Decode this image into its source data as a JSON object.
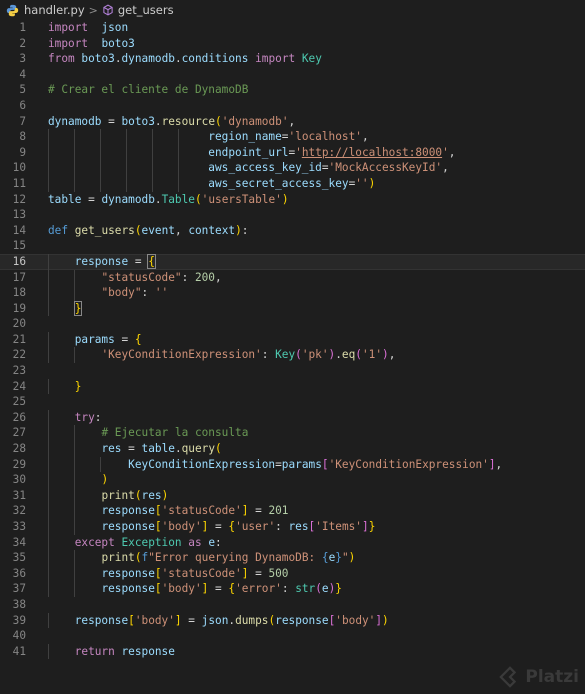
{
  "breadcrumb": {
    "file": "handler.py",
    "symbol": "get_users",
    "separator": ">"
  },
  "editor": {
    "current_line": 16,
    "lines": [
      {
        "n": "1",
        "t": [
          [
            "kw2",
            "import"
          ],
          [
            "",
            "  "
          ],
          [
            "var",
            "json"
          ]
        ]
      },
      {
        "n": "2",
        "t": [
          [
            "kw2",
            "import"
          ],
          [
            "",
            "  "
          ],
          [
            "var",
            "boto3"
          ]
        ]
      },
      {
        "n": "3",
        "t": [
          [
            "kw2",
            "from"
          ],
          [
            "",
            " "
          ],
          [
            "var",
            "boto3"
          ],
          [
            "",
            "."
          ],
          [
            "var",
            "dynamodb"
          ],
          [
            "",
            "."
          ],
          [
            "var",
            "conditions"
          ],
          [
            "",
            " "
          ],
          [
            "kw2",
            "import"
          ],
          [
            "",
            " "
          ],
          [
            "cls",
            "Key"
          ]
        ]
      },
      {
        "n": "4",
        "t": []
      },
      {
        "n": "5",
        "t": [
          [
            "cm",
            "# Crear el cliente de DynamoDB"
          ]
        ]
      },
      {
        "n": "6",
        "t": []
      },
      {
        "n": "7",
        "t": [
          [
            "var",
            "dynamodb"
          ],
          [
            "",
            " = "
          ],
          [
            "var",
            "boto3"
          ],
          [
            "",
            "."
          ],
          [
            "fn",
            "resource"
          ],
          [
            "br1",
            "("
          ],
          [
            "str",
            "'dynamodb'"
          ],
          [
            "",
            ","
          ]
        ]
      },
      {
        "n": "8",
        "t": [
          [
            "",
            "                        "
          ],
          [
            "var",
            "region_name"
          ],
          [
            "",
            "="
          ],
          [
            "str",
            "'localhost'"
          ],
          [
            "",
            ","
          ]
        ]
      },
      {
        "n": "9",
        "t": [
          [
            "",
            "                        "
          ],
          [
            "var",
            "endpoint_url"
          ],
          [
            "",
            "="
          ],
          [
            "str",
            "'"
          ],
          [
            "url",
            "http://localhost:8000"
          ],
          [
            "str",
            "'"
          ],
          [
            "",
            ","
          ]
        ]
      },
      {
        "n": "10",
        "t": [
          [
            "",
            "                        "
          ],
          [
            "var",
            "aws_access_key_id"
          ],
          [
            "",
            "="
          ],
          [
            "str",
            "'MockAccessKeyId'"
          ],
          [
            "",
            ","
          ]
        ]
      },
      {
        "n": "11",
        "t": [
          [
            "",
            "                        "
          ],
          [
            "var",
            "aws_secret_access_key"
          ],
          [
            "",
            "="
          ],
          [
            "str",
            "''"
          ],
          [
            "br1",
            ")"
          ]
        ]
      },
      {
        "n": "12",
        "t": [
          [
            "var",
            "table"
          ],
          [
            "",
            " = "
          ],
          [
            "var",
            "dynamodb"
          ],
          [
            "",
            "."
          ],
          [
            "cls",
            "Table"
          ],
          [
            "br1",
            "("
          ],
          [
            "str",
            "'usersTable'"
          ],
          [
            "br1",
            ")"
          ]
        ]
      },
      {
        "n": "13",
        "t": []
      },
      {
        "n": "14",
        "t": [
          [
            "kw",
            "def"
          ],
          [
            "",
            " "
          ],
          [
            "fn",
            "get_users"
          ],
          [
            "br1",
            "("
          ],
          [
            "var",
            "event"
          ],
          [
            "",
            ", "
          ],
          [
            "var",
            "context"
          ],
          [
            "br1",
            ")"
          ],
          [
            "",
            ":"
          ]
        ]
      },
      {
        "n": "15",
        "t": []
      },
      {
        "n": "16",
        "t": [
          [
            "",
            "    "
          ],
          [
            "var",
            "response"
          ],
          [
            "",
            " = "
          ],
          [
            "br1 brbox",
            "{"
          ]
        ]
      },
      {
        "n": "17",
        "t": [
          [
            "",
            "        "
          ],
          [
            "str",
            "\"statusCode\""
          ],
          [
            "",
            ": "
          ],
          [
            "num",
            "200"
          ],
          [
            "",
            ","
          ]
        ]
      },
      {
        "n": "18",
        "t": [
          [
            "",
            "        "
          ],
          [
            "str",
            "\"body\""
          ],
          [
            "",
            ": "
          ],
          [
            "str",
            "''"
          ]
        ]
      },
      {
        "n": "19",
        "t": [
          [
            "",
            "    "
          ],
          [
            "br1 brbox",
            "}"
          ]
        ]
      },
      {
        "n": "20",
        "t": []
      },
      {
        "n": "21",
        "t": [
          [
            "",
            "    "
          ],
          [
            "var",
            "params"
          ],
          [
            "",
            " = "
          ],
          [
            "br1",
            "{"
          ]
        ]
      },
      {
        "n": "22",
        "t": [
          [
            "",
            "        "
          ],
          [
            "str",
            "'KeyConditionExpression'"
          ],
          [
            "",
            ": "
          ],
          [
            "cls",
            "Key"
          ],
          [
            "br2",
            "("
          ],
          [
            "str",
            "'pk'"
          ],
          [
            "br2",
            ")"
          ],
          [
            "",
            "."
          ],
          [
            "fn",
            "eq"
          ],
          [
            "br2",
            "("
          ],
          [
            "str",
            "'1'"
          ],
          [
            "br2",
            ")"
          ],
          [
            "",
            ","
          ]
        ]
      },
      {
        "n": "23",
        "t": []
      },
      {
        "n": "24",
        "t": [
          [
            "",
            "    "
          ],
          [
            "br1",
            "}"
          ]
        ]
      },
      {
        "n": "25",
        "t": []
      },
      {
        "n": "26",
        "t": [
          [
            "",
            "    "
          ],
          [
            "kw2",
            "try"
          ],
          [
            "",
            ":"
          ]
        ]
      },
      {
        "n": "27",
        "t": [
          [
            "",
            "        "
          ],
          [
            "cm",
            "# Ejecutar la consulta"
          ]
        ]
      },
      {
        "n": "28",
        "t": [
          [
            "",
            "        "
          ],
          [
            "var",
            "res"
          ],
          [
            "",
            " = "
          ],
          [
            "var",
            "table"
          ],
          [
            "",
            "."
          ],
          [
            "fn",
            "query"
          ],
          [
            "br1",
            "("
          ]
        ]
      },
      {
        "n": "29",
        "t": [
          [
            "",
            "            "
          ],
          [
            "var",
            "KeyConditionExpression"
          ],
          [
            "",
            "="
          ],
          [
            "var",
            "params"
          ],
          [
            "br2",
            "["
          ],
          [
            "str",
            "'KeyConditionExpression'"
          ],
          [
            "br2",
            "]"
          ],
          [
            "",
            ","
          ]
        ]
      },
      {
        "n": "30",
        "t": [
          [
            "",
            "        "
          ],
          [
            "br1",
            ")"
          ]
        ]
      },
      {
        "n": "31",
        "t": [
          [
            "",
            "        "
          ],
          [
            "fn",
            "print"
          ],
          [
            "br1",
            "("
          ],
          [
            "var",
            "res"
          ],
          [
            "br1",
            ")"
          ]
        ]
      },
      {
        "n": "32",
        "t": [
          [
            "",
            "        "
          ],
          [
            "var",
            "response"
          ],
          [
            "br1",
            "["
          ],
          [
            "str",
            "'statusCode'"
          ],
          [
            "br1",
            "]"
          ],
          [
            "",
            " = "
          ],
          [
            "num",
            "201"
          ]
        ]
      },
      {
        "n": "33",
        "t": [
          [
            "",
            "        "
          ],
          [
            "var",
            "response"
          ],
          [
            "br1",
            "["
          ],
          [
            "str",
            "'body'"
          ],
          [
            "br1",
            "]"
          ],
          [
            "",
            " = "
          ],
          [
            "br1",
            "{"
          ],
          [
            "str",
            "'user'"
          ],
          [
            "",
            ": "
          ],
          [
            "var",
            "res"
          ],
          [
            "br2",
            "["
          ],
          [
            "str",
            "'Items'"
          ],
          [
            "br2",
            "]"
          ],
          [
            "br1",
            "}"
          ]
        ]
      },
      {
        "n": "34",
        "t": [
          [
            "",
            "    "
          ],
          [
            "kw2",
            "except"
          ],
          [
            "",
            " "
          ],
          [
            "cls",
            "Exception"
          ],
          [
            "",
            " "
          ],
          [
            "kw2",
            "as"
          ],
          [
            "",
            " "
          ],
          [
            "var",
            "e"
          ],
          [
            "",
            ":"
          ]
        ]
      },
      {
        "n": "35",
        "t": [
          [
            "",
            "        "
          ],
          [
            "fn",
            "print"
          ],
          [
            "br1",
            "("
          ],
          [
            "kw",
            "f"
          ],
          [
            "str",
            "\"Error querying DynamoDB: "
          ],
          [
            "kw",
            "{"
          ],
          [
            "var",
            "e"
          ],
          [
            "kw",
            "}"
          ],
          [
            "str",
            "\""
          ],
          [
            "br1",
            ")"
          ]
        ]
      },
      {
        "n": "36",
        "t": [
          [
            "",
            "        "
          ],
          [
            "var",
            "response"
          ],
          [
            "br1",
            "["
          ],
          [
            "str",
            "'statusCode'"
          ],
          [
            "br1",
            "]"
          ],
          [
            "",
            " = "
          ],
          [
            "num",
            "500"
          ]
        ]
      },
      {
        "n": "37",
        "t": [
          [
            "",
            "        "
          ],
          [
            "var",
            "response"
          ],
          [
            "br1",
            "["
          ],
          [
            "str",
            "'body'"
          ],
          [
            "br1",
            "]"
          ],
          [
            "",
            " = "
          ],
          [
            "br1",
            "{"
          ],
          [
            "str",
            "'error'"
          ],
          [
            "",
            ": "
          ],
          [
            "cls",
            "str"
          ],
          [
            "br2",
            "("
          ],
          [
            "var",
            "e"
          ],
          [
            "br2",
            ")"
          ],
          [
            "br1",
            "}"
          ]
        ]
      },
      {
        "n": "38",
        "t": []
      },
      {
        "n": "39",
        "t": [
          [
            "",
            "    "
          ],
          [
            "var",
            "response"
          ],
          [
            "br1",
            "["
          ],
          [
            "str",
            "'body'"
          ],
          [
            "br1",
            "]"
          ],
          [
            "",
            " = "
          ],
          [
            "var",
            "json"
          ],
          [
            "",
            "."
          ],
          [
            "fn",
            "dumps"
          ],
          [
            "br1",
            "("
          ],
          [
            "var",
            "response"
          ],
          [
            "br2",
            "["
          ],
          [
            "str",
            "'body'"
          ],
          [
            "br2",
            "]"
          ],
          [
            "br1",
            ")"
          ]
        ]
      },
      {
        "n": "40",
        "t": []
      },
      {
        "n": "41",
        "t": [
          [
            "",
            "    "
          ],
          [
            "kw2",
            "return"
          ],
          [
            "",
            " "
          ],
          [
            "var",
            "response"
          ]
        ]
      }
    ]
  },
  "watermark": {
    "text": "Platzi"
  },
  "colors": {
    "background": "#1e1e1e",
    "keyword": "#569cd6",
    "control": "#c586c0",
    "function": "#dcdcaa",
    "variable": "#9cdcfe",
    "string": "#ce9178",
    "number": "#b5cea8",
    "comment": "#6a9955",
    "class": "#4ec9b0"
  }
}
